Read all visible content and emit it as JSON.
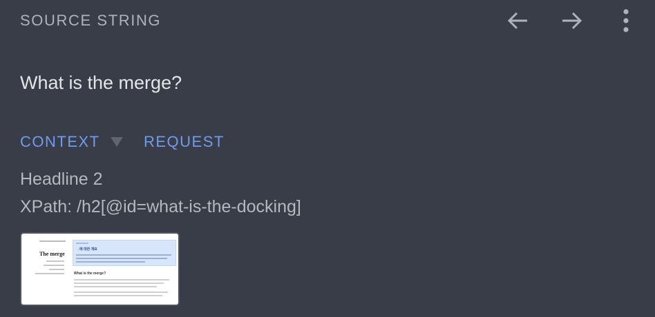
{
  "header": {
    "title": "SOURCE STRING",
    "prev_icon": "arrow-left-icon",
    "next_icon": "arrow-right-icon",
    "more_icon": "more-vertical-icon"
  },
  "source": {
    "text": "What is the merge?"
  },
  "tabs": [
    {
      "label": "CONTEXT",
      "icon": "caret-down-icon"
    },
    {
      "label": "REQUEST"
    }
  ],
  "context": {
    "type": "Headline 2",
    "xpath": "XPath: /h2[@id=what-is-the-docking]"
  },
  "screenshot": {
    "sidebar_title": "The merge",
    "banner_title": "→에 대한 개요",
    "heading": "What is the merge?"
  },
  "colors": {
    "background": "#393d47",
    "accent": "#6f9cf0",
    "muted_text": "#aeb3bb",
    "primary_text": "#e3e5e8"
  }
}
